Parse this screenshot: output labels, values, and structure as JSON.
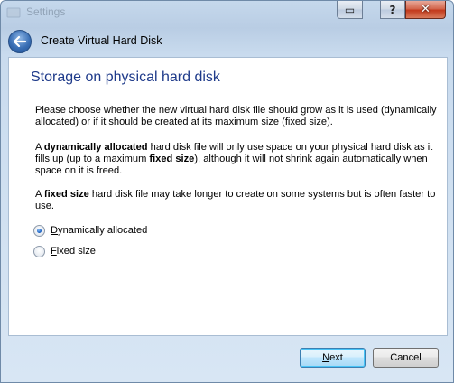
{
  "window": {
    "title": "Settings",
    "controls": {
      "restore_symbol": "▭",
      "help_symbol": "?",
      "close_symbol": "✕"
    }
  },
  "header": {
    "dialog_title": "Create Virtual Hard Disk"
  },
  "page": {
    "heading": "Storage on physical hard disk",
    "paragraph1": "Please choose whether the new virtual hard disk file should grow as it is used (dynamically allocated) or if it should be created at its maximum size (fixed size).",
    "paragraph2": {
      "pre": "A ",
      "bold1": "dynamically allocated",
      "mid": " hard disk file will only use space on your physical hard disk as it fills up (up to a maximum ",
      "bold2": "fixed size",
      "post": "), although it will not shrink again automatically when space on it is freed."
    },
    "paragraph3": {
      "pre": "A ",
      "bold": "fixed size",
      "post": " hard disk file may take longer to create on some systems but is often faster to use."
    },
    "options": [
      {
        "label_accel": "D",
        "label_rest": "ynamically allocated",
        "selected": true
      },
      {
        "label_accel": "F",
        "label_rest": "ixed size",
        "selected": false
      }
    ]
  },
  "footer": {
    "next": {
      "accel": "N",
      "rest": "ext"
    },
    "cancel_label": "Cancel"
  },
  "colors": {
    "heading": "#1e3a8a",
    "selected_radio": "#1b63c6",
    "close_button": "#c2391b"
  }
}
